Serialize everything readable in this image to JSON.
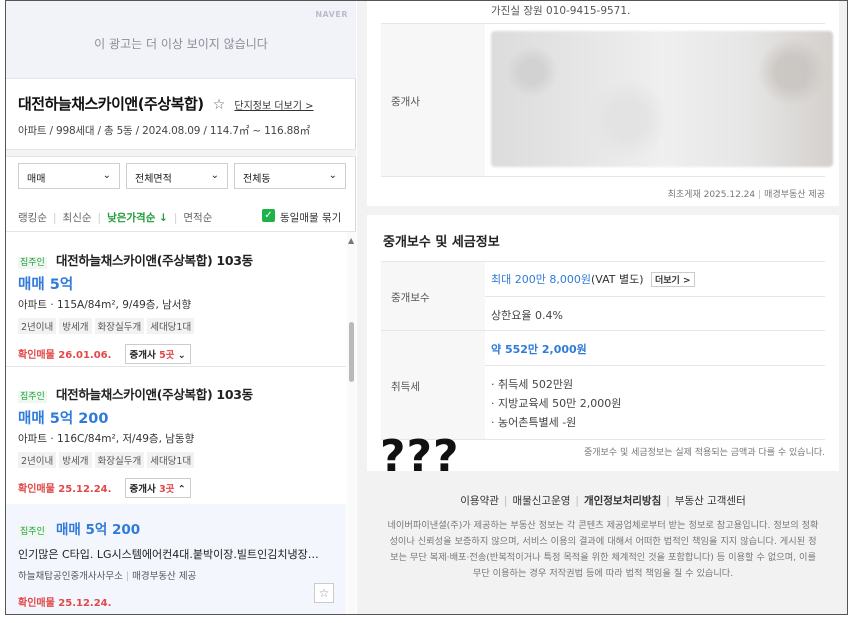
{
  "ad": {
    "brand": "NAVER",
    "message": "이 광고는 더 이상 보이지 않습니다"
  },
  "complex": {
    "title": "대전하늘채스카이앤(주상복합)",
    "star": "☆",
    "more_link": "단지정보 더보기 >",
    "summary": "아파트 / 998세대 / 총 5동 / 2024.08.09 / 114.7㎡ ~ 116.88㎡"
  },
  "filters": {
    "trade_type": "매매",
    "area": "전체면적",
    "building": "전체동"
  },
  "sort": {
    "ranking": "랭킹순",
    "latest": "최신순",
    "low_price": "낮은가격순 ↓",
    "area": "면적순",
    "checkbox_label": "동일매물 묶기"
  },
  "listings": [
    {
      "owner_tag": "집주인",
      "title": "대전하늘채스카이앤(주상복합) 103동",
      "price": "매매 5억",
      "spec": "아파트 · 115A/84m², 9/49층, 남서향",
      "chips": [
        "2년이내",
        "방세개",
        "화장실두개",
        "세대당1대"
      ],
      "confirm": "확인매물 26.01.06.",
      "agent_prefix": "중개사 ",
      "agent_count": "5곳",
      "agent_suffix": " ⌄"
    },
    {
      "owner_tag": "집주인",
      "title": "대전하늘채스카이앤(주상복합) 103동",
      "price": "매매 5억 200",
      "spec": "아파트 · 116C/84m², 저/49층, 남동향",
      "chips": [
        "2년이내",
        "방세개",
        "화장실두개",
        "세대당1대"
      ],
      "confirm": "확인매물 25.12.24.",
      "agent_prefix": "중개사 ",
      "agent_count": "3곳",
      "agent_suffix": " ⌃"
    },
    {
      "owner_tag": "집주인",
      "price": "매매 5억 200",
      "description": "인기많은 C타입. LG시스템에어컨4대.붙박이장.빌트인김치냉장…",
      "broker": "하늘채탑공인중개사사무소",
      "provider": "매경부동산 제공",
      "confirm": "확인매물 25.12.24.",
      "fav": "☆"
    }
  ],
  "detail": {
    "phone_line": "가진실 장원 010-9415-9571.",
    "agent_label": "중개사",
    "first_listed": "최초게재 2025.12.24",
    "provider": "매경부동산 제공",
    "fee_section_title": "중개보수 및 세금정보",
    "fee_label": "중개보수",
    "fee_max": "최대 200만 8,000원",
    "fee_vat": "(VAT 별도)",
    "fee_more": "더보기 >",
    "rate": "상한요율 0.4%",
    "tax_label": "취득세",
    "tax_total": "약 552만 2,000원",
    "tax_items": [
      "· 취득세 502만원",
      "· 지방교육세 50만 2,000원",
      "· 농어촌특별세 -원"
    ],
    "note": "중개보수 및 세금정보는 실제 적용되는 금액과 다를 수 있습니다."
  },
  "overlay_text": "???",
  "footer": {
    "links": [
      "이용약관",
      "매물신고운영",
      "개인정보처리방침",
      "부동산 고객센터"
    ],
    "text": "네이버파이낸셜(주)가 제공하는 부동산 정보는 각 콘텐츠 제공업체로부터 받는 정보로 참고용입니다. 정보의 정확성이나 신뢰성을 보증하지 않으며, 서비스 이용의 결과에 대해서 어떠한 법적인 책임을 지지 않습니다. 게시된 정보는 무단 복제·배포·전송(반복적이거나 특정 목적을 위한 체계적인 것을 포함합니다) 등 이용할 수 없으며, 이를 무단 이용하는 경우 저작권법 등에 따라 법적 책임을 질 수 있습니다."
  },
  "colors": {
    "accent_green": "#1f9d3a",
    "price_blue": "#2f7bd9",
    "confirm_red": "#e24848"
  }
}
